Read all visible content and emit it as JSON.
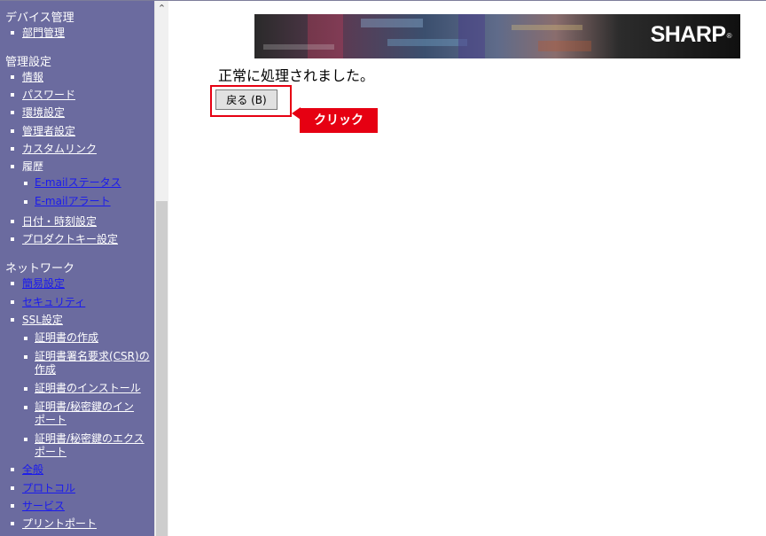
{
  "sidebar": {
    "device_section": {
      "title": "デバイス管理",
      "items": [
        "部門管理"
      ]
    },
    "admin_section": {
      "title": "管理設定",
      "items": [
        "情報",
        "パスワード",
        "環境設定",
        "管理者設定",
        "カスタムリンク",
        "履歴"
      ],
      "history_sub": [
        "E-mailステータス",
        "E-mailアラート"
      ],
      "items2": [
        "日付・時刻設定",
        "プロダクトキー設定"
      ]
    },
    "network_section": {
      "title": "ネットワーク",
      "items": [
        "簡易設定",
        "セキュリティ",
        "SSL設定"
      ],
      "ssl_sub": [
        [
          "証明書の作成"
        ],
        [
          "証明書署名要求(CSR)の",
          "作成"
        ],
        [
          "証明書のインストール"
        ],
        [
          "証明書/秘密鍵のイン",
          "ポート"
        ],
        [
          "証明書/秘密鍵のエクス",
          "ポート"
        ]
      ],
      "items2": [
        "全般",
        "プロトコル",
        "サービス",
        "プリントポート"
      ]
    }
  },
  "banner": {
    "logo_text": "SHARP",
    "logo_mark": "®"
  },
  "main": {
    "message": "正常に処理されました。",
    "back_button_label": "戻る (B)",
    "callout_text": "クリック"
  },
  "colors": {
    "sidebar_bg": "#6b6b9f",
    "accent_red": "#e60012",
    "link_blue": "#1a1aee"
  }
}
